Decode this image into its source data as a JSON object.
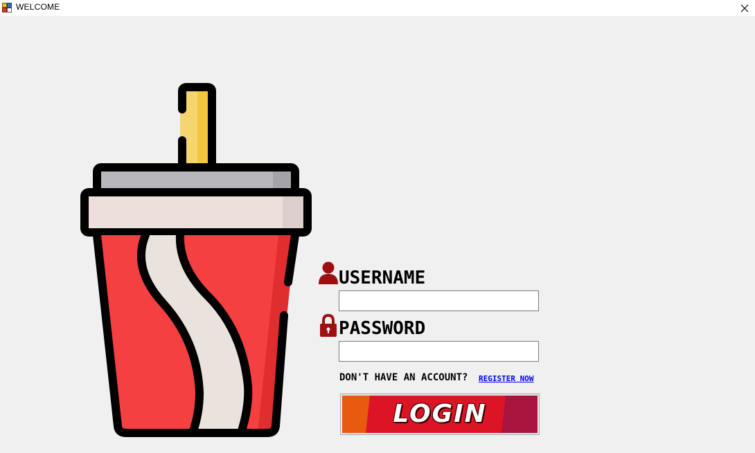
{
  "window": {
    "title": "WELCOME",
    "icon": "app-window-icon",
    "close_icon": "close-icon"
  },
  "illustration": {
    "icon": "soda-cup-icon",
    "colors": {
      "cup": "#f44040",
      "cup_shadow": "#e02d2d",
      "lid": "#ede0dc",
      "lid_top": "#b8b8bc",
      "straw": "#f5d56e",
      "stripe": "#eae2dd",
      "outline": "#000000"
    }
  },
  "form": {
    "username": {
      "icon": "user-icon",
      "label": "USERNAME",
      "value": ""
    },
    "password": {
      "icon": "lock-icon",
      "label": "PASSWORD",
      "value": ""
    },
    "account_prompt": "DON'T HAVE AN ACCOUNT?",
    "register_link": "REGISTER NOW",
    "login_button": {
      "label": "LOGIN",
      "colors": [
        "#e85a10",
        "#dd1425",
        "#a8143c"
      ]
    },
    "icon_color": "#9e1010"
  }
}
